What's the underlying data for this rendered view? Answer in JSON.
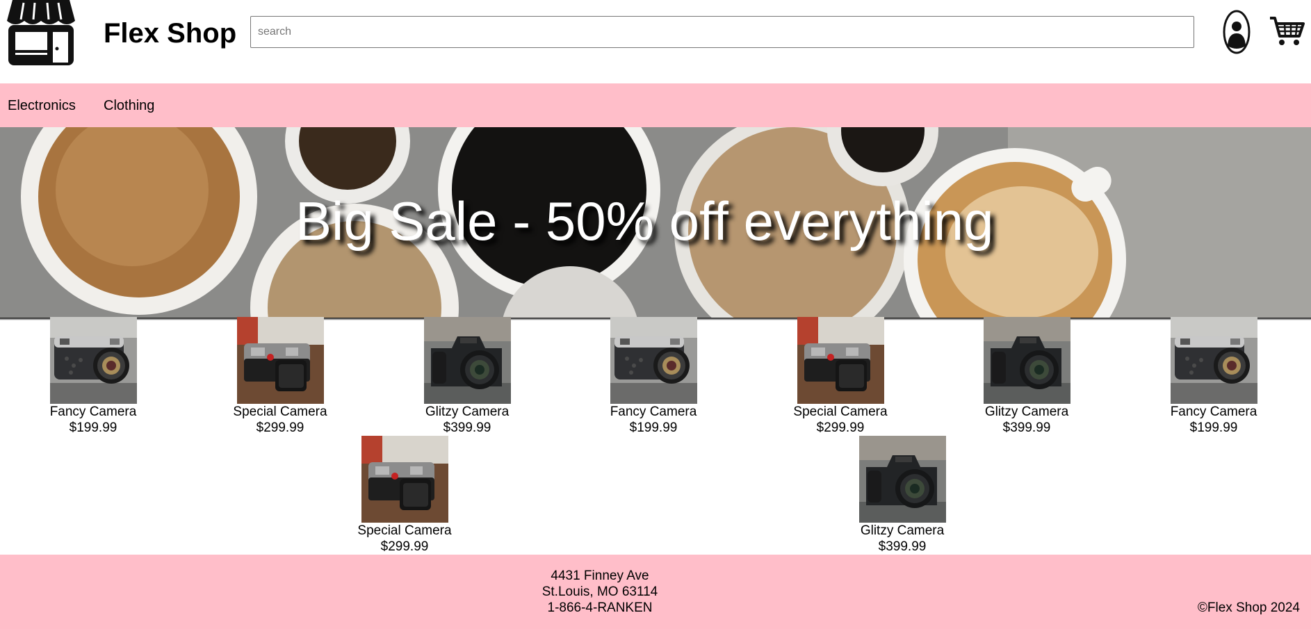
{
  "header": {
    "title": "Flex Shop",
    "search_placeholder": "search",
    "search_value": ""
  },
  "nav": {
    "items": [
      "Electronics",
      "Clothing"
    ]
  },
  "banner": {
    "text": "Big Sale - 50% off everything"
  },
  "products": [
    {
      "name": "Fancy Camera",
      "price": "$199.99"
    },
    {
      "name": "Special Camera",
      "price": "$299.99"
    },
    {
      "name": "Glitzy Camera",
      "price": "$399.99"
    },
    {
      "name": "Fancy Camera",
      "price": "$199.99"
    },
    {
      "name": "Special Camera",
      "price": "$299.99"
    },
    {
      "name": "Glitzy Camera",
      "price": "$399.99"
    },
    {
      "name": "Fancy Camera",
      "price": "$199.99"
    },
    {
      "name": "Special Camera",
      "price": "$299.99"
    },
    {
      "name": "Glitzy Camera",
      "price": "$399.99"
    }
  ],
  "footer": {
    "address_line1": "4431 Finney Ave",
    "address_line2": "St.Louis, MO 63114",
    "phone": "1-866-4-RANKEN",
    "copyright": "©Flex Shop 2024"
  },
  "colors": {
    "nav_bg": "#ffbec9",
    "footer_bg": "#ffbec9"
  },
  "icons": [
    "store-logo-icon",
    "user-icon",
    "cart-icon"
  ]
}
